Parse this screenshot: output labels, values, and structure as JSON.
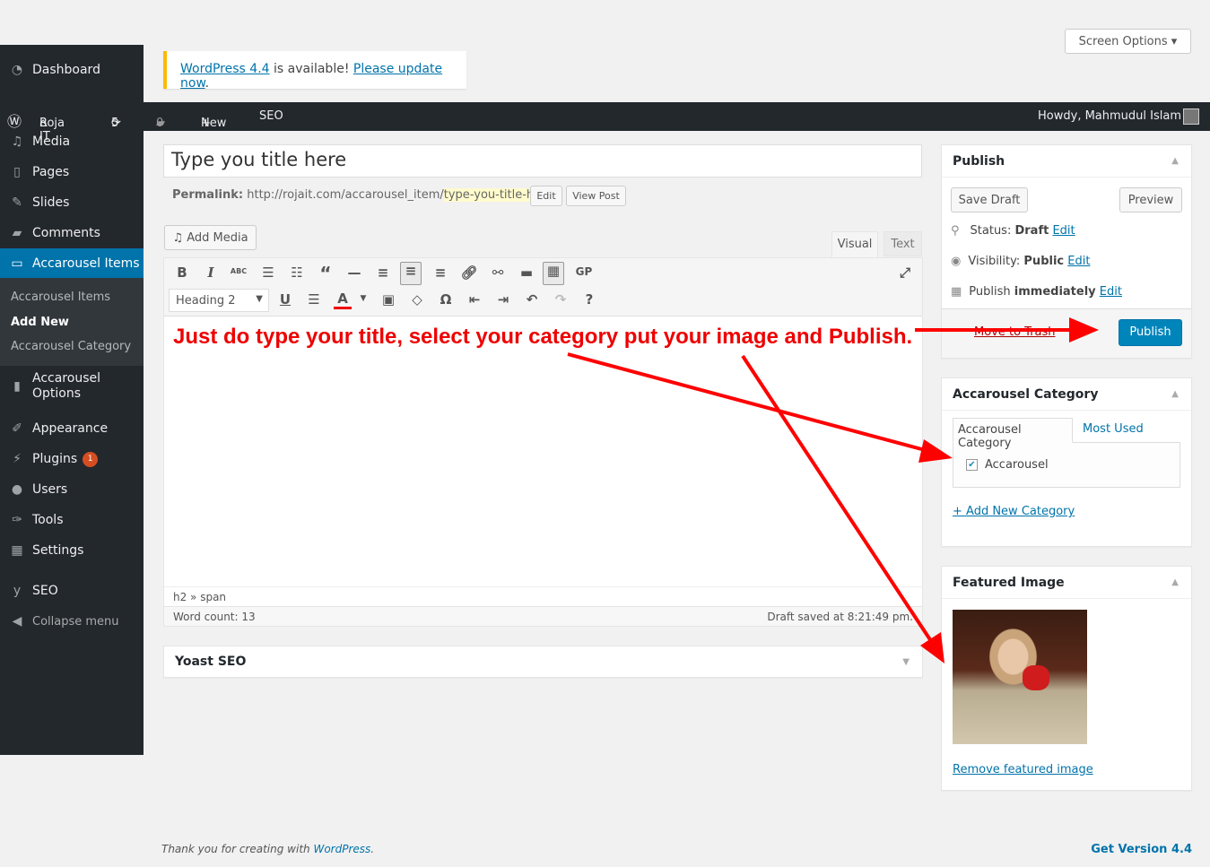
{
  "screen_options": "Screen Options",
  "notice": {
    "link1": "WordPress 4.4",
    "mid": " is available! ",
    "link2": "Please update now",
    "end": "."
  },
  "adminbar": {
    "site": "Roja IT",
    "updates": "5",
    "comments": "0",
    "new": "New",
    "seo": "SEO",
    "howdy": "Howdy, Mahmudul Islam"
  },
  "sidebar": {
    "dashboard": "Dashboard",
    "media": "Media",
    "pages": "Pages",
    "slides": "Slides",
    "comments": "Comments",
    "accarousel_items": "Accarousel Items",
    "sub": [
      "Accarousel Items",
      "Add New",
      "Accarousel Category"
    ],
    "accarousel_options": "Accarousel Options",
    "appearance": "Appearance",
    "plugins": "Plugins",
    "plugins_badge": "1",
    "users": "Users",
    "tools": "Tools",
    "settings": "Settings",
    "seo": "SEO",
    "collapse": "Collapse menu"
  },
  "editor": {
    "title": "Type you title here",
    "permalink_label": "Permalink:",
    "permalink_base": "http://rojait.com/accarousel_item/",
    "permalink_slug": "type-you-title-here/",
    "edit": "Edit",
    "view_post": "View Post",
    "add_media": "Add Media",
    "tab_visual": "Visual",
    "tab_text": "Text",
    "format": "Heading 2",
    "content": "Just do type your title, select your category put your image and Publish.",
    "path": "h2 » span",
    "word_count": "Word count: 13",
    "draft_saved": "Draft saved at 8:21:49 pm."
  },
  "yoast": "Yoast SEO",
  "publish": {
    "title": "Publish",
    "save_draft": "Save Draft",
    "preview": "Preview",
    "status_label": "Status: ",
    "status": "Draft",
    "visibility_label": "Visibility: ",
    "visibility": "Public",
    "publish_label": "Publish ",
    "publish_when": "immediately",
    "edit": "Edit",
    "trash": "Move to Trash",
    "publish_btn": "Publish"
  },
  "category": {
    "title": "Accarousel Category",
    "tab_all": "Accarousel Category",
    "tab_used": "Most Used",
    "item": "Accarousel",
    "add_new": "+ Add New Category"
  },
  "featured": {
    "title": "Featured Image",
    "remove": "Remove featured image"
  },
  "footer": {
    "thanks": "Thank you for creating with ",
    "wp": "WordPress",
    "end": ".",
    "version": "Get Version 4.4"
  },
  "colors": {
    "accent": "#0073aa",
    "annotation": "#ff0000",
    "sidebar": "#23282d"
  }
}
